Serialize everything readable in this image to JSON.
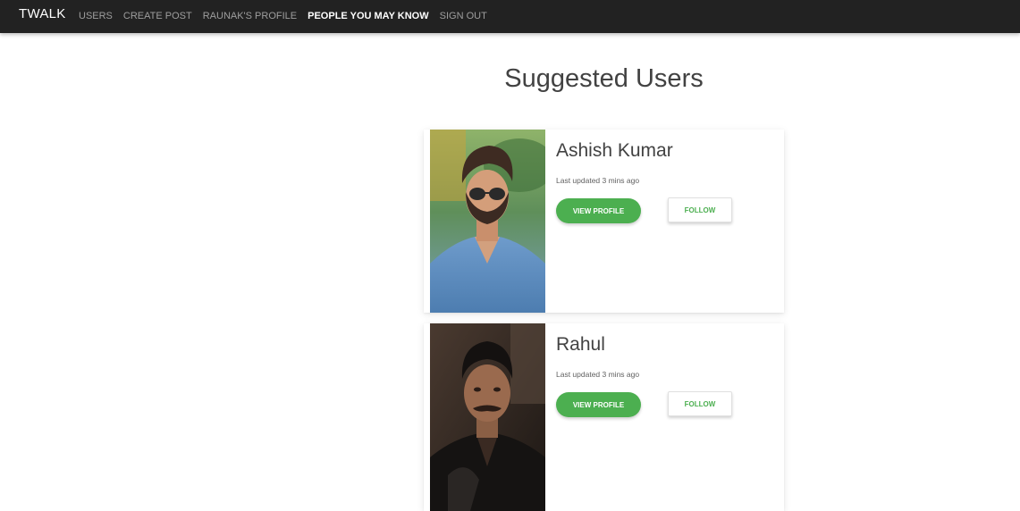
{
  "nav": {
    "brand": "TWALK",
    "links": [
      {
        "label": "USERS"
      },
      {
        "label": "CREATE POST"
      },
      {
        "label": "RAUNAK'S PROFILE"
      },
      {
        "label": "PEOPLE YOU MAY KNOW"
      },
      {
        "label": "SIGN OUT"
      }
    ]
  },
  "page": {
    "title": "Suggested Users"
  },
  "users": [
    {
      "name": "Ashish Kumar",
      "updated": "Last updated 3 mins ago",
      "view_label": "VIEW PROFILE",
      "follow_label": "FOLLOW"
    },
    {
      "name": "Rahul",
      "updated": "Last updated 3 mins ago",
      "view_label": "VIEW PROFILE",
      "follow_label": "FOLLOW"
    }
  ],
  "colors": {
    "navbar": "#222222",
    "accent_green": "#4caf50",
    "text": "#424242"
  }
}
